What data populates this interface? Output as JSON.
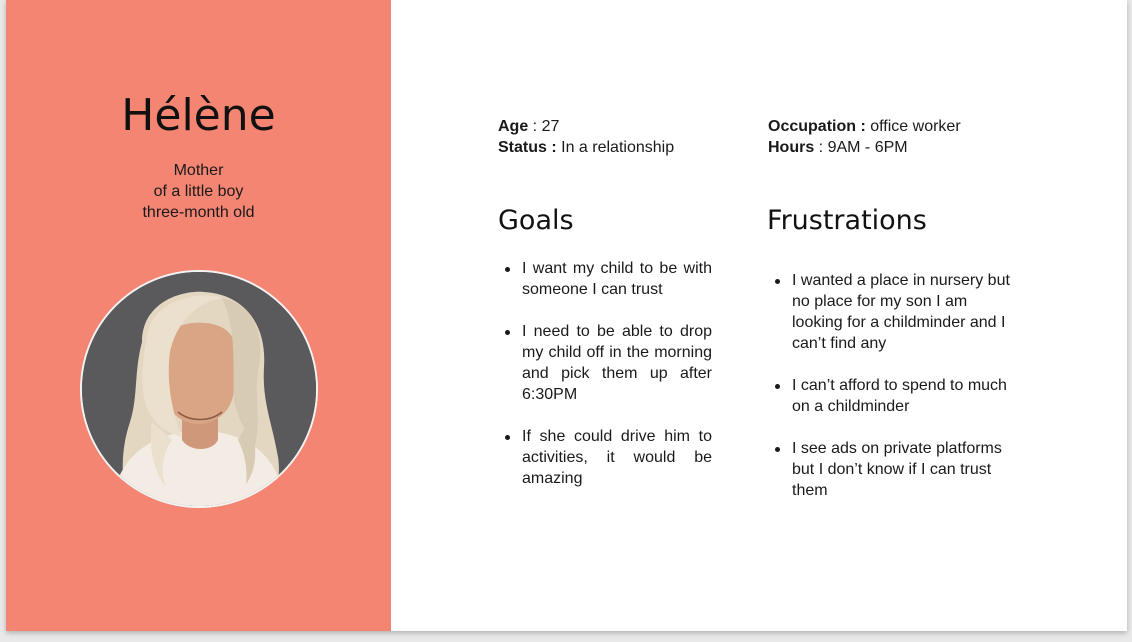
{
  "persona": {
    "name": "Hélène",
    "subtitle_lines": [
      "Mother",
      "of a little boy",
      "three-month old"
    ]
  },
  "details": {
    "age_label": "Age",
    "age_value": "27",
    "status_label": "Status :",
    "status_value": "In a relationship",
    "occupation_label": "Occupation :",
    "occupation_value": "office worker",
    "hours_label": "Hours",
    "hours_value": "9AM - 6PM"
  },
  "goals": {
    "title": "Goals",
    "items": [
      "I want my child to be with someone I can trust",
      "I need to be able to drop my child off in the morning and pick them up after 6:30PM",
      "If she could drive him to activities, it would be amazing"
    ]
  },
  "frustrations": {
    "title": "Frustrations",
    "items": [
      "I wanted a place in nursery but no place for my son I am looking for a childminder and I can’t find any",
      "I can’t afford to spend to much on a childminder",
      "I see ads on private platforms but I don’t know if I can trust them"
    ]
  },
  "colors": {
    "panel": "#f48573",
    "avatar_background": "#5a5a5c",
    "hair": "#e3d7c2",
    "skin": "#d9a584",
    "shirt": "#f3ece4"
  },
  "icons": {
    "avatar": "woman-portrait-icon"
  }
}
